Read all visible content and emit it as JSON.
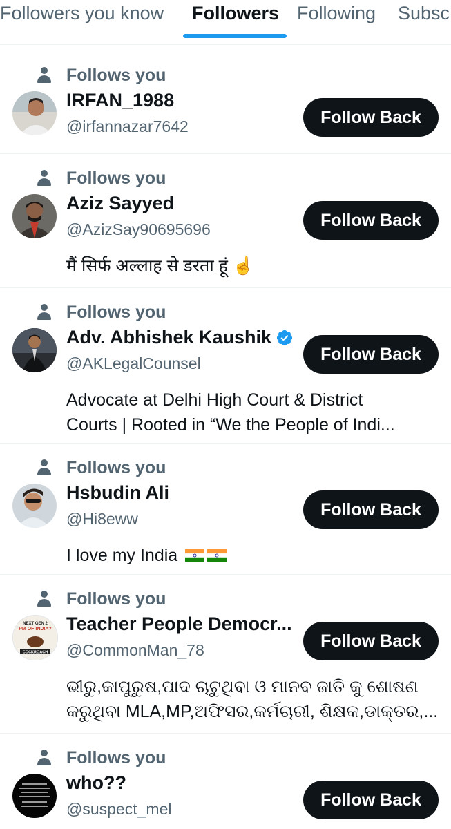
{
  "tabs": [
    {
      "label": "Followers you know"
    },
    {
      "label": "Followers"
    },
    {
      "label": "Following"
    },
    {
      "label": "Subsc"
    }
  ],
  "active_tab": "Followers",
  "accent_color": "#1d9bf0",
  "follows_you_label": "Follows you",
  "follow_back_label": "Follow Back",
  "followers": [
    {
      "name": "IRFAN_1988",
      "handle": "@irfannazar7642",
      "bio_lines": []
    },
    {
      "name": "Aziz Sayyed",
      "handle": "@AzizSay90695696",
      "bio_lines": [
        "मैं सिर्फ अल्लाह से डरता हूं"
      ]
    },
    {
      "name": "Adv. Abhishek Kaushik",
      "handle": "@AKLegalCounsel",
      "verified": true,
      "bio_lines": [
        "Advocate at Delhi High Court & District",
        "Courts | Rooted in “We the People of Indi..."
      ]
    },
    {
      "name": "Hsbudin Ali",
      "handle": "@Hi8eww",
      "bio_lines": [
        "I love my India"
      ]
    },
    {
      "name": "Teacher People Democr...",
      "handle": "@CommonMan_78",
      "bio_lines": [
        "ଭୀରୁ,କାପୁରୁଷ,ପାଦ ଚାଟୁଥିବା ଓ ମାନବ ଜାତି କୁ ଶୋଷଣ",
        "କରୁଥିବା MLA,MP,ଅଫିସର,କର୍ମଚାରୀ, ଶିକ୍ଷକ,ଡାକ୍ତର,..."
      ]
    },
    {
      "name": "who??",
      "handle": "@suspect_mel",
      "bio_lines": []
    }
  ],
  "avatar_text": {
    "teacher": [
      "NEXT GEN 2",
      "PM OF INDIA?",
      "COCKROACH"
    ]
  }
}
